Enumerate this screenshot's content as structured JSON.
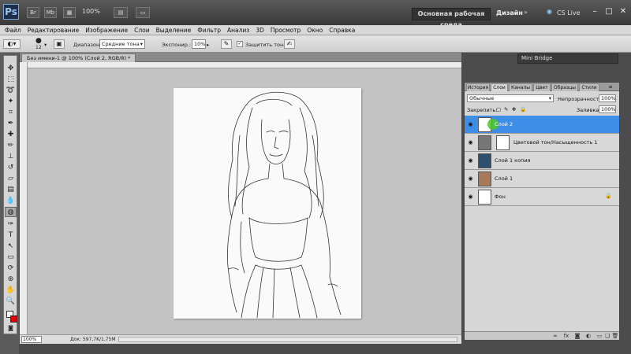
{
  "app": {
    "logo": "Ps",
    "menu_btn_1": "Br",
    "menu_btn_2": "Mb",
    "zoom": "100%",
    "workspace_button": "Основная рабочая среда",
    "workspace_design": "Дизайн",
    "cs_live": "CS Live"
  },
  "menu": [
    "Файл",
    "Редактирование",
    "Изображение",
    "Слои",
    "Выделение",
    "Фильтр",
    "Анализ",
    "3D",
    "Просмотр",
    "Окно",
    "Справка"
  ],
  "options": {
    "brush_size": "12",
    "range_label": "Диапазон:",
    "range_value": "Средние тона",
    "exposure_label": "Экспонир.:",
    "exposure_value": "10%",
    "protect_tones": "Защитить тона"
  },
  "document": {
    "tab_title": "Без имени-1 @ 100% (Слой 2, RGB/8) *",
    "status_zoom": "100%",
    "status_doc": "Док: 597,7K/1,75M"
  },
  "mini_bridge": "Mini Bridge",
  "layers_panel": {
    "tabs": [
      "История",
      "Слои",
      "Каналы",
      "Цвет",
      "Образцы",
      "Стили"
    ],
    "active_tab": "Слои",
    "blend_mode": "Обычные",
    "opacity_label": "Непрозрачность:",
    "opacity_value": "100%",
    "lock_label": "Закрепить:",
    "fill_label": "Заливка:",
    "fill_value": "100%",
    "layers": [
      {
        "name": "Слой 2",
        "selected": true
      },
      {
        "name": "Цветовой тон/Насыщенность 1",
        "selected": false
      },
      {
        "name": "Слой 1 копия",
        "selected": false
      },
      {
        "name": "Слой 1",
        "selected": false
      },
      {
        "name": "Фон",
        "selected": false
      }
    ]
  },
  "colors": {
    "selection_blue": "#3d8ee6",
    "foreground": "#ffffff",
    "background": "#e00000"
  }
}
